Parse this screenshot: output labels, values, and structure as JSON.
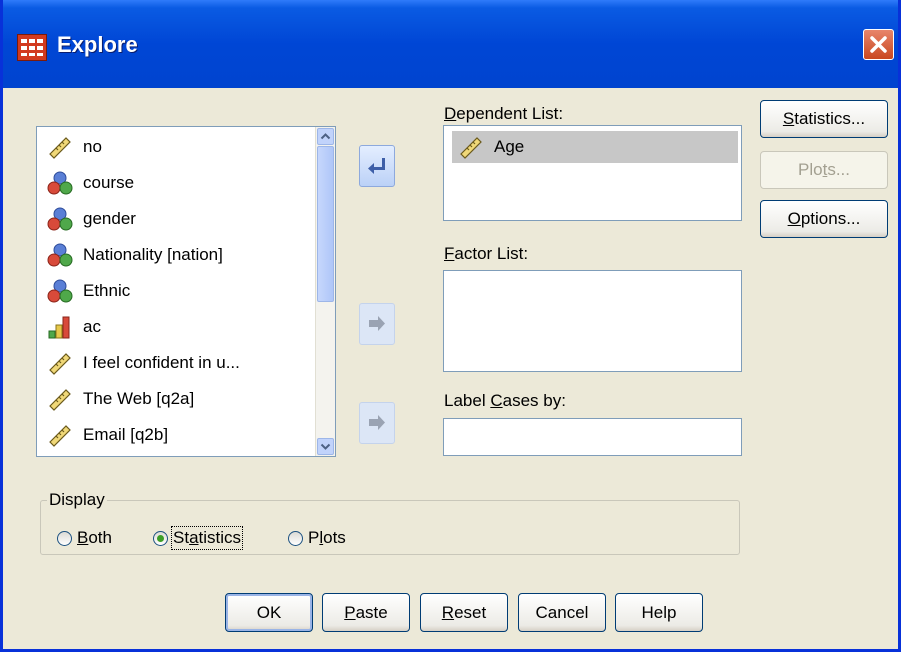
{
  "window": {
    "title": "Explore"
  },
  "variables": [
    {
      "label": "no",
      "icon": "ruler-icon"
    },
    {
      "label": "course",
      "icon": "nominal-icon"
    },
    {
      "label": "gender",
      "icon": "nominal-icon"
    },
    {
      "label": "Nationality [nation]",
      "icon": "nominal-icon"
    },
    {
      "label": "Ethnic",
      "icon": "nominal-icon"
    },
    {
      "label": "ac",
      "icon": "ordinal-bar-icon"
    },
    {
      "label": "I feel confident in u...",
      "icon": "ruler-icon"
    },
    {
      "label": "The Web [q2a]",
      "icon": "ruler-icon"
    },
    {
      "label": "Email [q2b]",
      "icon": "ruler-icon"
    }
  ],
  "dependent_list": {
    "label_pre": "",
    "label_u": "D",
    "label_post": "ependent List:",
    "items": [
      "Age"
    ]
  },
  "factor_list": {
    "label_pre": "",
    "label_u": "F",
    "label_post": "actor List:"
  },
  "label_cases": {
    "label_pre": "Label ",
    "label_u": "C",
    "label_post": "ases by:",
    "value": ""
  },
  "side_buttons": {
    "statistics": {
      "pre": "",
      "u": "S",
      "post": "tatistics..."
    },
    "plots": {
      "pre": "Plo",
      "u": "t",
      "post": "s..."
    },
    "options": {
      "pre": "",
      "u": "O",
      "post": "ptions..."
    }
  },
  "display": {
    "legend": "Display",
    "options": [
      {
        "pre": "",
        "u": "B",
        "post": "oth",
        "selected": false
      },
      {
        "pre": "St",
        "u": "a",
        "post": "tistics",
        "selected": true
      },
      {
        "pre": "P",
        "u": "l",
        "post": "ots",
        "selected": false
      }
    ]
  },
  "bottom_buttons": {
    "ok": "OK",
    "paste": {
      "pre": "",
      "u": "P",
      "post": "aste"
    },
    "reset": {
      "pre": "",
      "u": "R",
      "post": "eset"
    },
    "cancel": "Cancel",
    "help": "Help"
  },
  "colors": {
    "title_bar": "#0046D5",
    "dialog_bg": "#ECE9D8",
    "border": "#7F9DB9",
    "selection": "#C7C7C7"
  }
}
